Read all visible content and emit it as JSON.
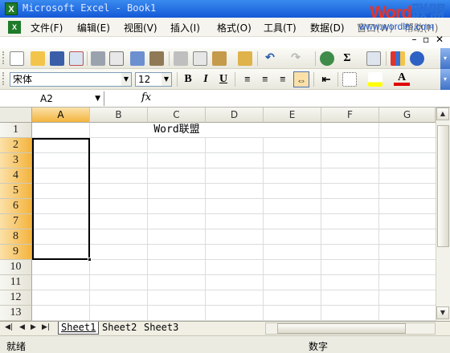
{
  "titlebar": {
    "title": "Microsoft Excel - Book1",
    "logo_word": "Word",
    "logo_cn": "联盟"
  },
  "menubar": {
    "items": [
      "文件(F)",
      "编辑(E)",
      "视图(V)",
      "插入(I)",
      "格式(O)",
      "工具(T)",
      "数据(D)",
      "窗口(W)",
      "帮助(H)"
    ],
    "url": "www.wordlm.com"
  },
  "formatting": {
    "font_name": "宋体",
    "font_size": "12",
    "bold": "B",
    "italic": "I",
    "underline": "U",
    "font_color_letter": "A"
  },
  "standard_toolbar": {
    "sum_symbol": "Σ"
  },
  "formula_bar": {
    "name_box": "A2",
    "fx_label": "fx",
    "content": ""
  },
  "columns": [
    "A",
    "B",
    "C",
    "D",
    "E",
    "F",
    "G"
  ],
  "rows": [
    "1",
    "2",
    "3",
    "4",
    "5",
    "6",
    "7",
    "8",
    "9",
    "10",
    "11",
    "12",
    "13"
  ],
  "selection": {
    "column": "A",
    "rows": [
      "2",
      "3",
      "4",
      "5",
      "6",
      "7",
      "8",
      "9"
    ]
  },
  "cells": {
    "merged_B1_D1": "Word联盟"
  },
  "sheet_tabs": [
    "Sheet1",
    "Sheet2",
    "Sheet3"
  ],
  "active_sheet": "Sheet1",
  "statusbar": {
    "left": "就绪",
    "mode": "数字"
  },
  "colors": {
    "titlebar": "#1459d6",
    "selection_header": "#f4b43e",
    "grid_line": "#dadcdd",
    "font_color_bar": "#e00000",
    "fill_color_bar": "#ffff00"
  }
}
